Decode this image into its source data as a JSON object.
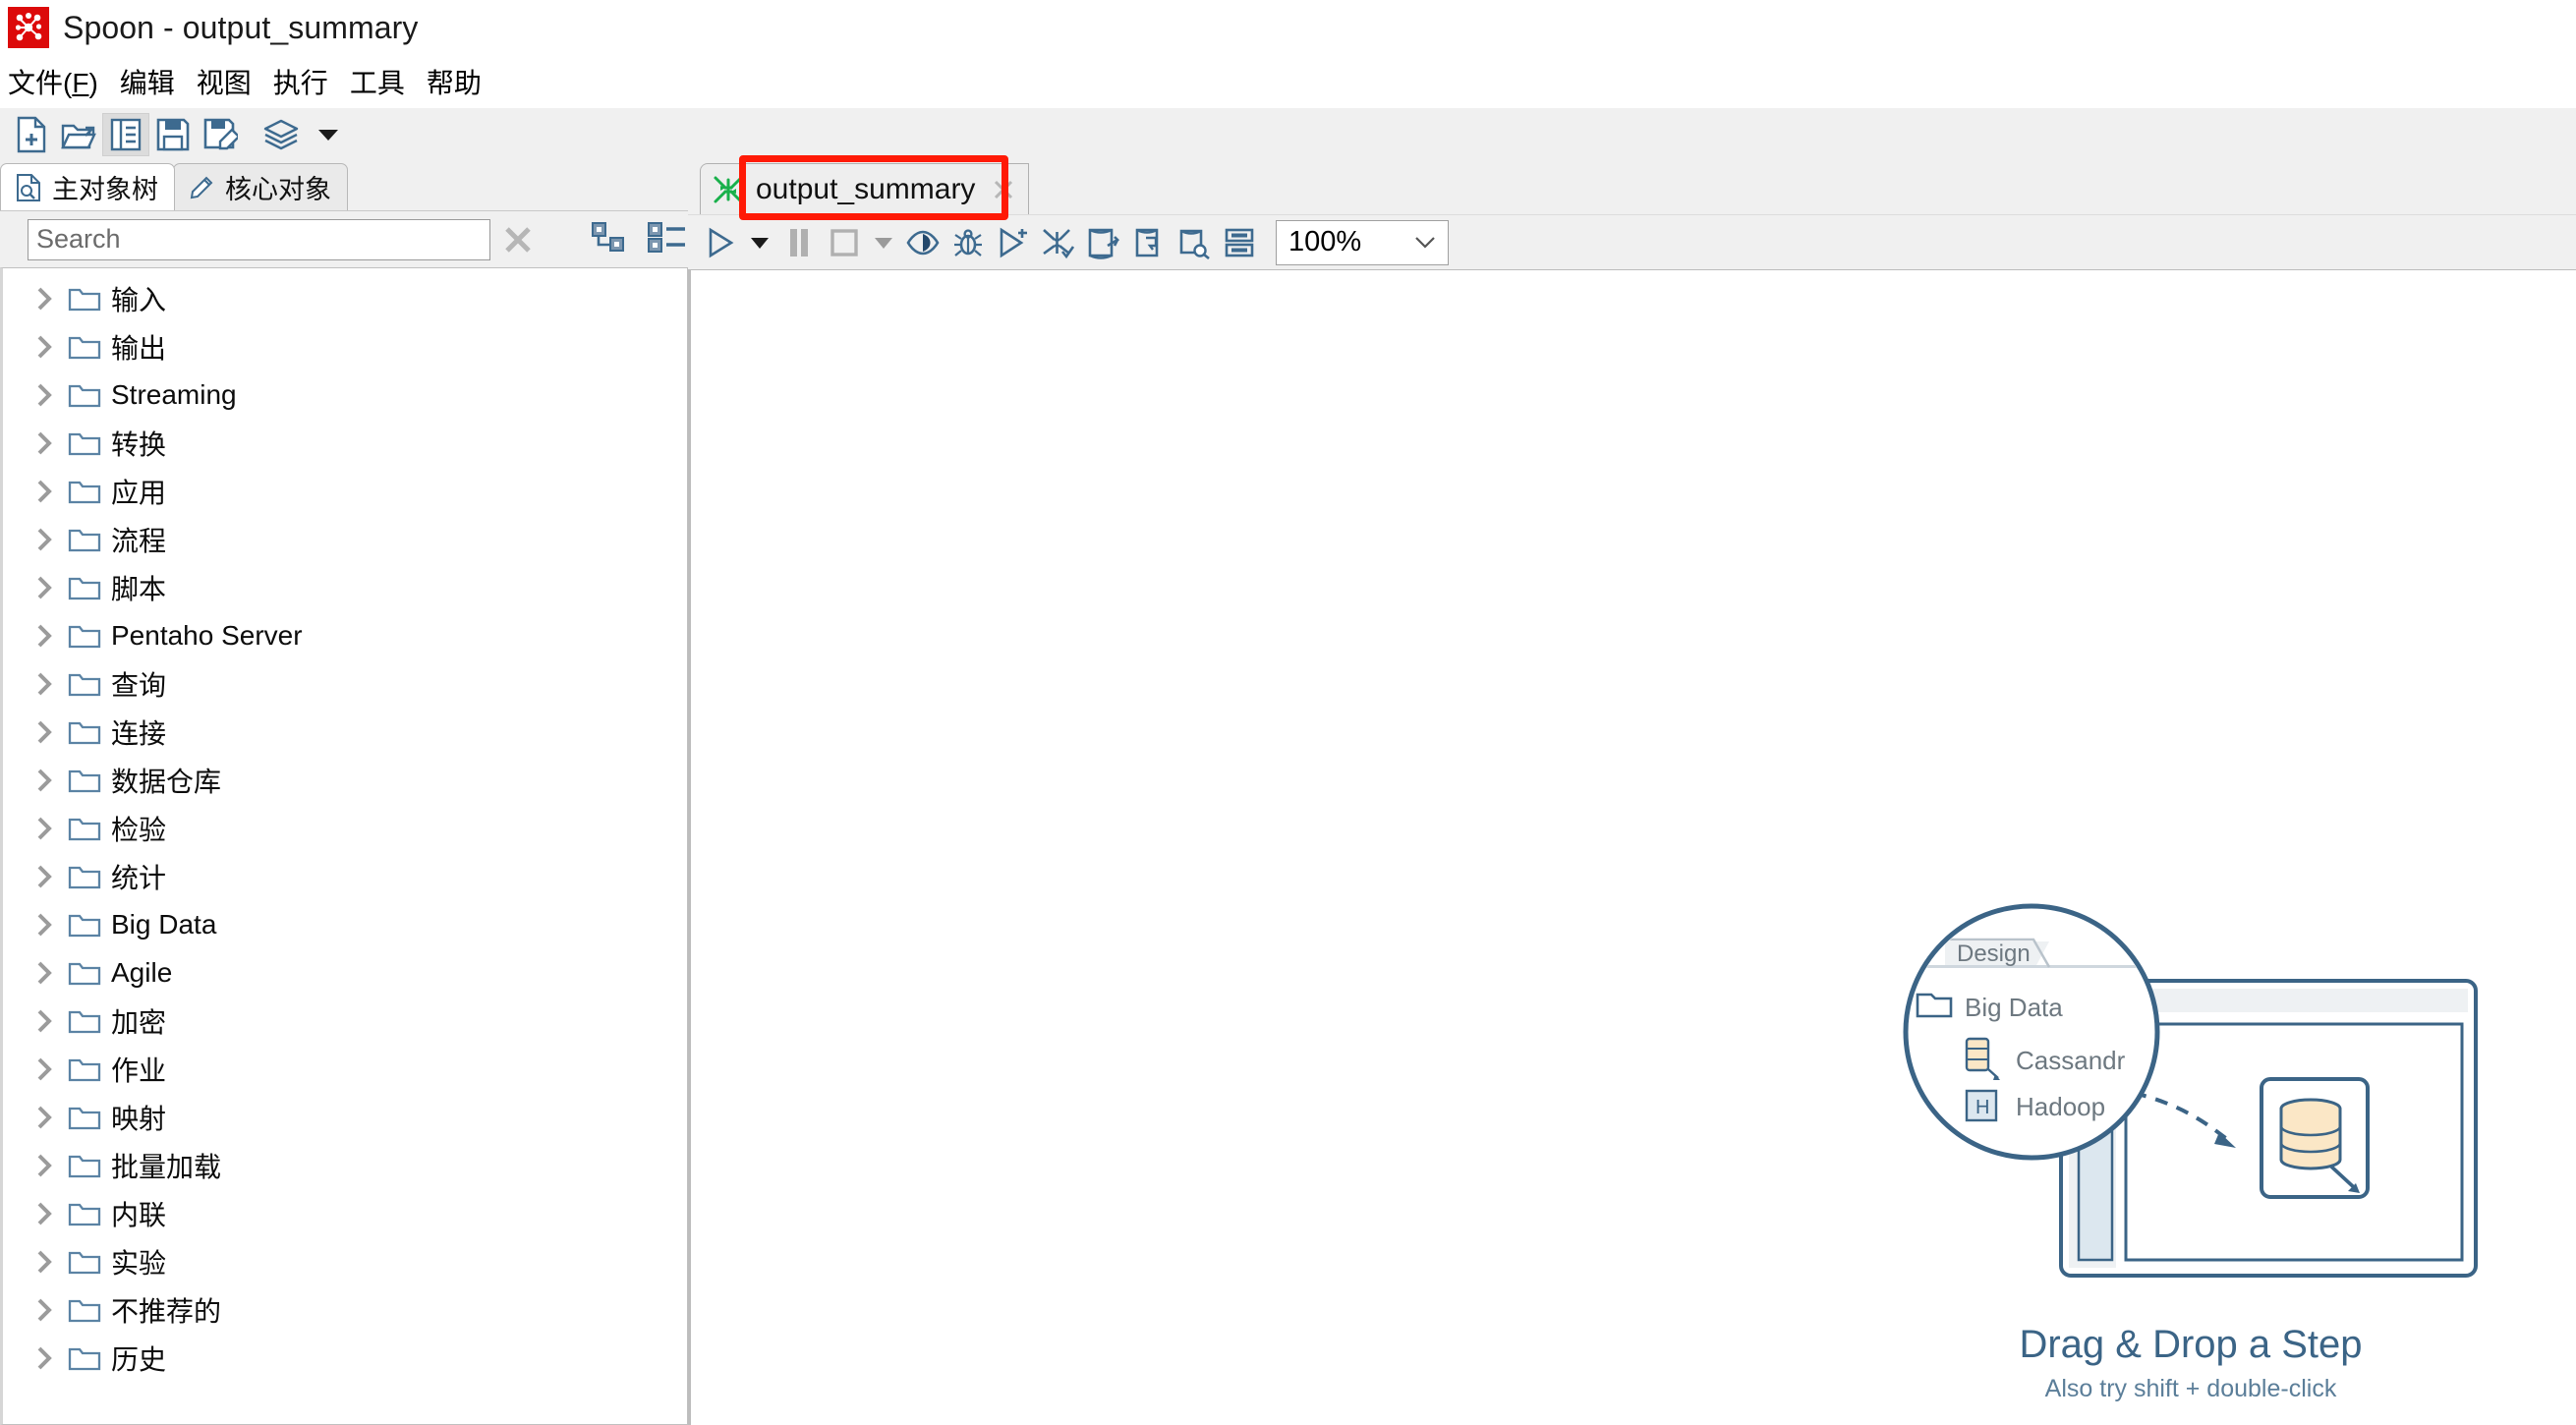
{
  "window": {
    "title": "Spoon - output_summary",
    "logo_icon": "pentaho-spoon-logo-icon"
  },
  "menubar": {
    "items": [
      {
        "label": "文件(F)",
        "name": "menu-file"
      },
      {
        "label": "编辑",
        "name": "menu-edit"
      },
      {
        "label": "视图",
        "name": "menu-view"
      },
      {
        "label": "执行",
        "name": "menu-run"
      },
      {
        "label": "工具",
        "name": "menu-tools"
      },
      {
        "label": "帮助",
        "name": "menu-help"
      }
    ]
  },
  "main_toolbar": {
    "buttons": [
      {
        "icon": "new-file-icon",
        "name": "new-transformation-button"
      },
      {
        "icon": "open-folder-icon",
        "name": "open-file-button"
      },
      {
        "icon": "explore-repository-icon",
        "name": "explore-repository-button"
      },
      {
        "icon": "save-icon",
        "name": "save-button"
      },
      {
        "icon": "save-as-icon",
        "name": "save-as-button"
      },
      {
        "icon": "layers-icon",
        "name": "perspective-button"
      },
      {
        "icon": "chevron-down-icon",
        "name": "perspective-dropdown-button"
      }
    ]
  },
  "sidebar": {
    "tabs": [
      {
        "label": "主对象树",
        "icon": "document-search-icon",
        "active": true,
        "name": "tab-main-object-tree"
      },
      {
        "label": "核心对象",
        "icon": "pencil-icon",
        "active": false,
        "name": "tab-core-objects"
      }
    ],
    "search": {
      "placeholder": "Search",
      "value": "",
      "clear_icon": "close-x-icon"
    },
    "tree_tools": [
      {
        "icon": "collapse-tree-icon",
        "name": "collapse-all-button"
      },
      {
        "icon": "expand-tree-icon",
        "name": "expand-all-button"
      }
    ],
    "tree_items": [
      {
        "label": "输入"
      },
      {
        "label": "输出"
      },
      {
        "label": "Streaming"
      },
      {
        "label": "转换"
      },
      {
        "label": "应用"
      },
      {
        "label": "流程"
      },
      {
        "label": "脚本"
      },
      {
        "label": "Pentaho Server"
      },
      {
        "label": "查询"
      },
      {
        "label": "连接"
      },
      {
        "label": "数据仓库"
      },
      {
        "label": "检验"
      },
      {
        "label": "统计"
      },
      {
        "label": "Big Data"
      },
      {
        "label": "Agile"
      },
      {
        "label": "加密"
      },
      {
        "label": "作业"
      },
      {
        "label": "映射"
      },
      {
        "label": "批量加载"
      },
      {
        "label": "内联"
      },
      {
        "label": "实验"
      },
      {
        "label": "不推荐的"
      },
      {
        "label": "历史"
      }
    ]
  },
  "canvas_area": {
    "tabs": [
      {
        "label": "output_summary",
        "icon": "transformation-icon",
        "close_icon": "close-x-icon",
        "active": true,
        "highlighted": true
      }
    ],
    "toolbar": {
      "buttons": [
        {
          "icon": "run-icon",
          "name": "run-button"
        },
        {
          "icon": "chevron-down-icon",
          "name": "run-options-dropdown"
        },
        {
          "icon": "pause-icon",
          "name": "pause-button"
        },
        {
          "icon": "stop-icon",
          "name": "stop-button"
        },
        {
          "icon": "chevron-down-icon",
          "name": "stop-options-dropdown"
        },
        {
          "icon": "preview-icon",
          "name": "preview-button"
        },
        {
          "icon": "debug-bug-icon",
          "name": "debug-button"
        },
        {
          "icon": "run-replay-icon",
          "name": "replay-button"
        },
        {
          "icon": "verify-icon",
          "name": "verify-transformation-button"
        },
        {
          "icon": "impact-analysis-icon",
          "name": "impact-analysis-button"
        },
        {
          "icon": "generate-sql-icon",
          "name": "generate-sql-button"
        },
        {
          "icon": "database-explore-icon",
          "name": "explore-database-button"
        },
        {
          "icon": "show-grid-icon",
          "name": "show-execution-results-button"
        }
      ],
      "zoom": {
        "value": "100%",
        "chevron_icon": "chevron-down-icon"
      }
    },
    "watermark": {
      "title": "Drag & Drop a Step",
      "subtitle": "Also try shift + double-click",
      "magnifier": {
        "tab_label": "Design",
        "items": [
          {
            "label": "Big Data",
            "icon": "folder-icon"
          },
          {
            "label": "Cassandr",
            "icon": "cassandra-output-icon"
          },
          {
            "label": "Hadoop",
            "icon": "hadoop-icon"
          }
        ]
      }
    }
  },
  "colors": {
    "accent_blue": "#3b6486",
    "highlight_red": "#ff1a06",
    "logo_red": "#dc0a0a",
    "panel_gray": "#f0f0f0",
    "icon_blue": "#3d6a8f",
    "canvas_white": "#ffffff"
  }
}
